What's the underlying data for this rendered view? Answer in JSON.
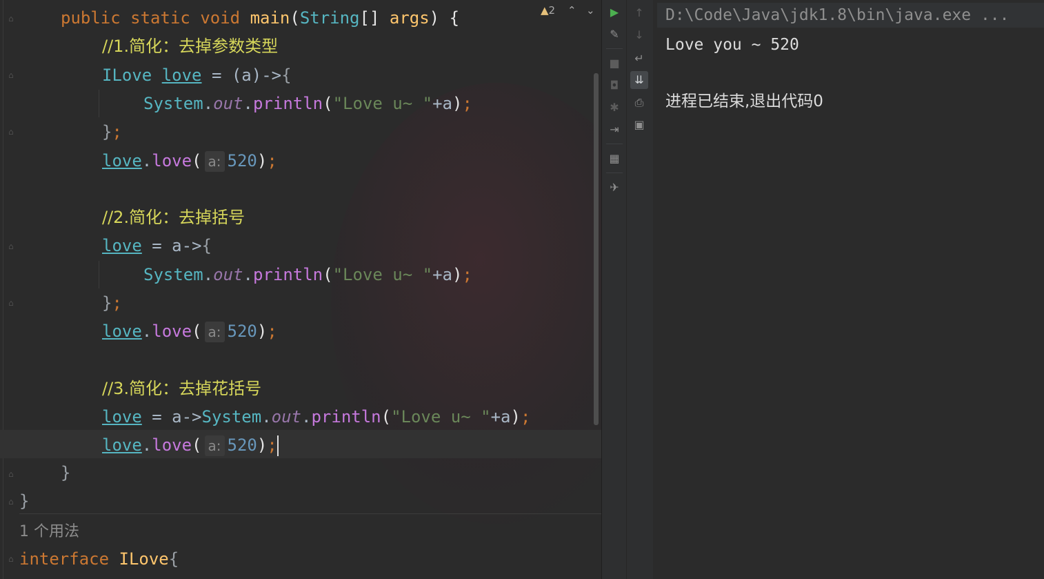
{
  "editor": {
    "warning_count": "2",
    "usage_hint": "1 个用法",
    "code": {
      "l1": {
        "kw1": "public",
        "kw2": "static",
        "kw3": "void",
        "fn": "main",
        "p1": "(",
        "ty": "String",
        "p2": "[] ",
        "arg": "args",
        "p3": ") {"
      },
      "l2": {
        "comment": "//1.简化：去掉参数类型"
      },
      "l3": {
        "ty": "ILove",
        "sp": " ",
        "var": "love",
        "op": " = (",
        "a": "a",
        "arrow": ")->",
        "brace": "{"
      },
      "l4": {
        "sys": "System",
        "dot": ".",
        "out": "out",
        "dot2": ".",
        "mth": "println",
        "p": "(",
        "str": "\"Love u~ \"",
        "plus": "+a",
        ")": ")",
        "semi": ";"
      },
      "l5": {
        "brace": "}",
        "semi": ";"
      },
      "l6": {
        "var": "love",
        "dot": ".",
        "mth": "love",
        "p": "(",
        "hint": "a:",
        "num": "520",
        "close": ")",
        "semi": ";"
      },
      "l8": {
        "comment": "//2.简化：去掉括号"
      },
      "l9": {
        "var": "love",
        "op": " = a->",
        "brace": "{"
      },
      "l10": {
        "sys": "System",
        "dot": ".",
        "out": "out",
        "dot2": ".",
        "mth": "println",
        "p": "(",
        "str": "\"Love u~ \"",
        "plus": "+a",
        ")": ")",
        "semi": ";"
      },
      "l11": {
        "brace": "}",
        "semi": ";"
      },
      "l12": {
        "var": "love",
        "dot": ".",
        "mth": "love",
        "p": "(",
        "hint": "a:",
        "num": "520",
        "close": ")",
        "semi": ";"
      },
      "l14": {
        "comment": "//3.简化：去掉花括号"
      },
      "l15": {
        "var": "love",
        "op": " = a->",
        "sys": "System",
        "dot": ".",
        "out": "out",
        "dot2": ".",
        "mth": "println",
        "p": "(",
        "str": "\"Love u~ \"",
        "plus": "+a",
        ")": ")",
        "semi": ";"
      },
      "l16": {
        "var": "love",
        "dot": ".",
        "mth": "love",
        "p": "(",
        "hint": "a:",
        "num": "520",
        "close": ")",
        "semi": ";"
      },
      "l17": {
        "brace": "}"
      },
      "l18": {
        "brace": "}"
      },
      "l20": {
        "kw": "interface",
        "ty": "ILove",
        "brace": "{"
      }
    }
  },
  "toolbar": {
    "icons": [
      "run-icon",
      "wrench-icon",
      "stop-icon",
      "camera-icon",
      "bug-icon",
      "exit-icon",
      "layout-icon",
      "pin-icon"
    ],
    "icons2": [
      "up-arrow-icon",
      "down-arrow-icon",
      "soft-wrap-icon",
      "scroll-to-end-icon",
      "print-icon",
      "trash-icon"
    ]
  },
  "console": {
    "command": "D:\\Code\\Java\\jdk1.8\\bin\\java.exe ...",
    "output_line": "Love you ~ 520",
    "exit_message": "进程已结束,退出代码0"
  }
}
